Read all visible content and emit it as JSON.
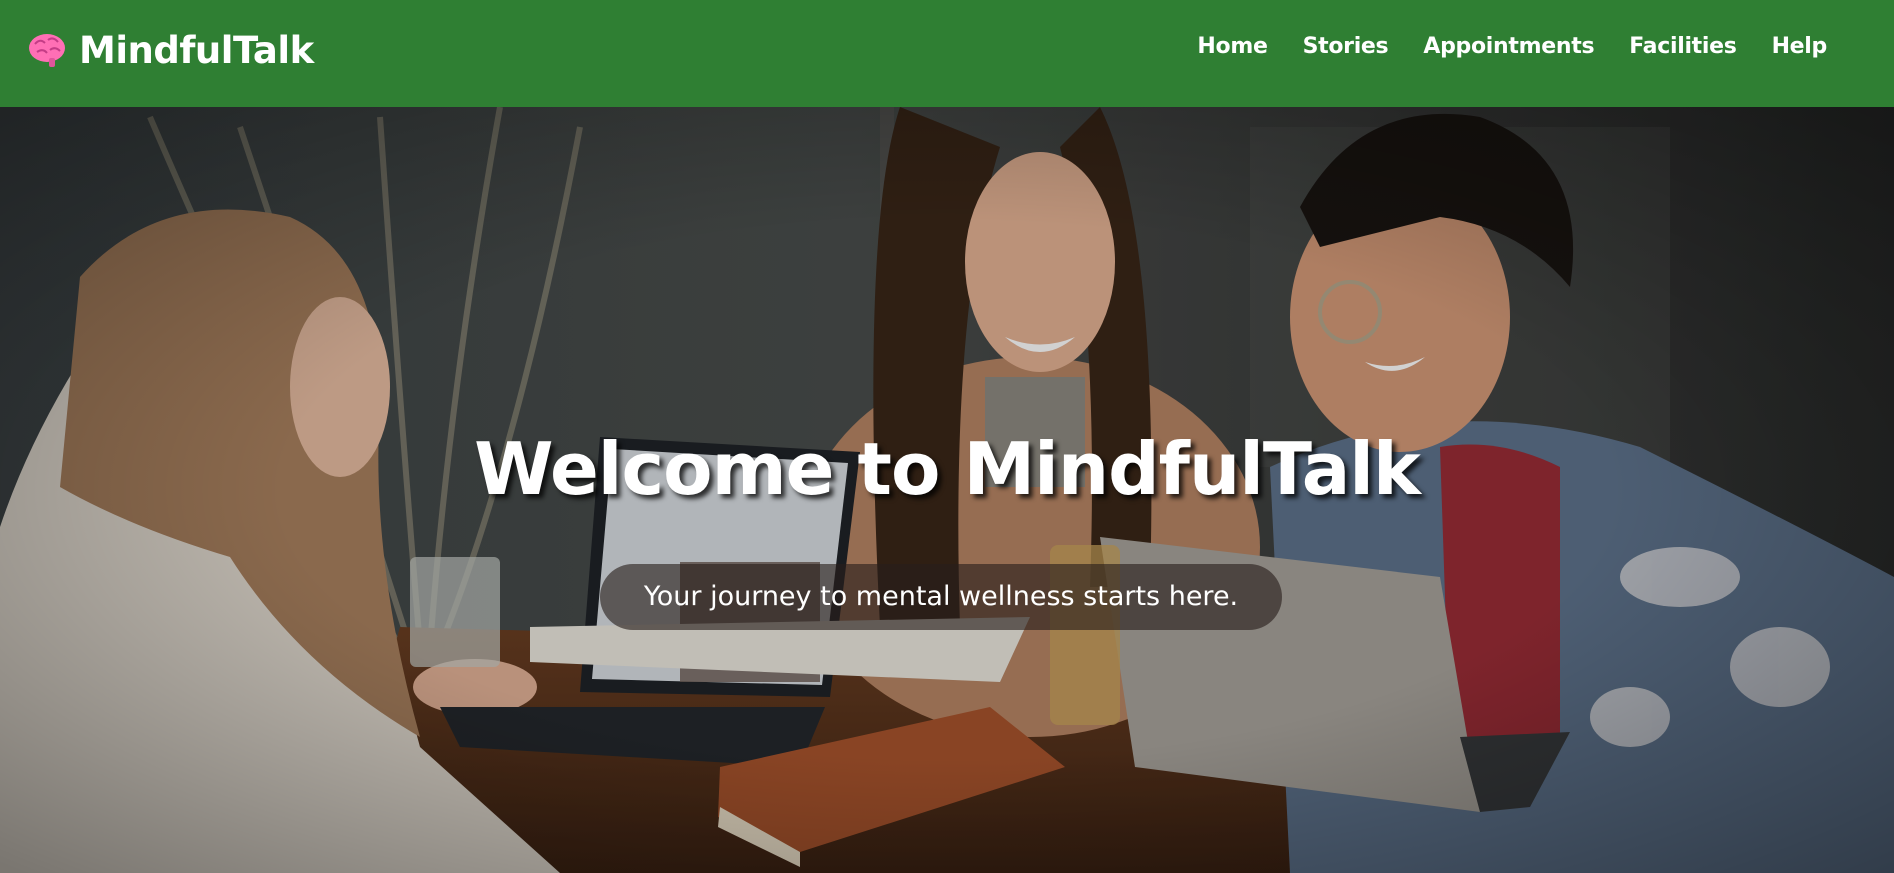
{
  "header": {
    "brand_name": "MindfulTalk",
    "brand_icon": "brain-icon",
    "background_color": "#2f7f33"
  },
  "nav": {
    "items": [
      {
        "label": "Home"
      },
      {
        "label": "Stories"
      },
      {
        "label": "Appointments"
      },
      {
        "label": "Facilities"
      },
      {
        "label": "Help"
      }
    ]
  },
  "hero": {
    "title": "Welcome to MindfulTalk",
    "subtitle": "Your journey to mental wellness starts here."
  },
  "colors": {
    "accent": "#2f7f33",
    "brain_icon": "#ff6fb5"
  }
}
